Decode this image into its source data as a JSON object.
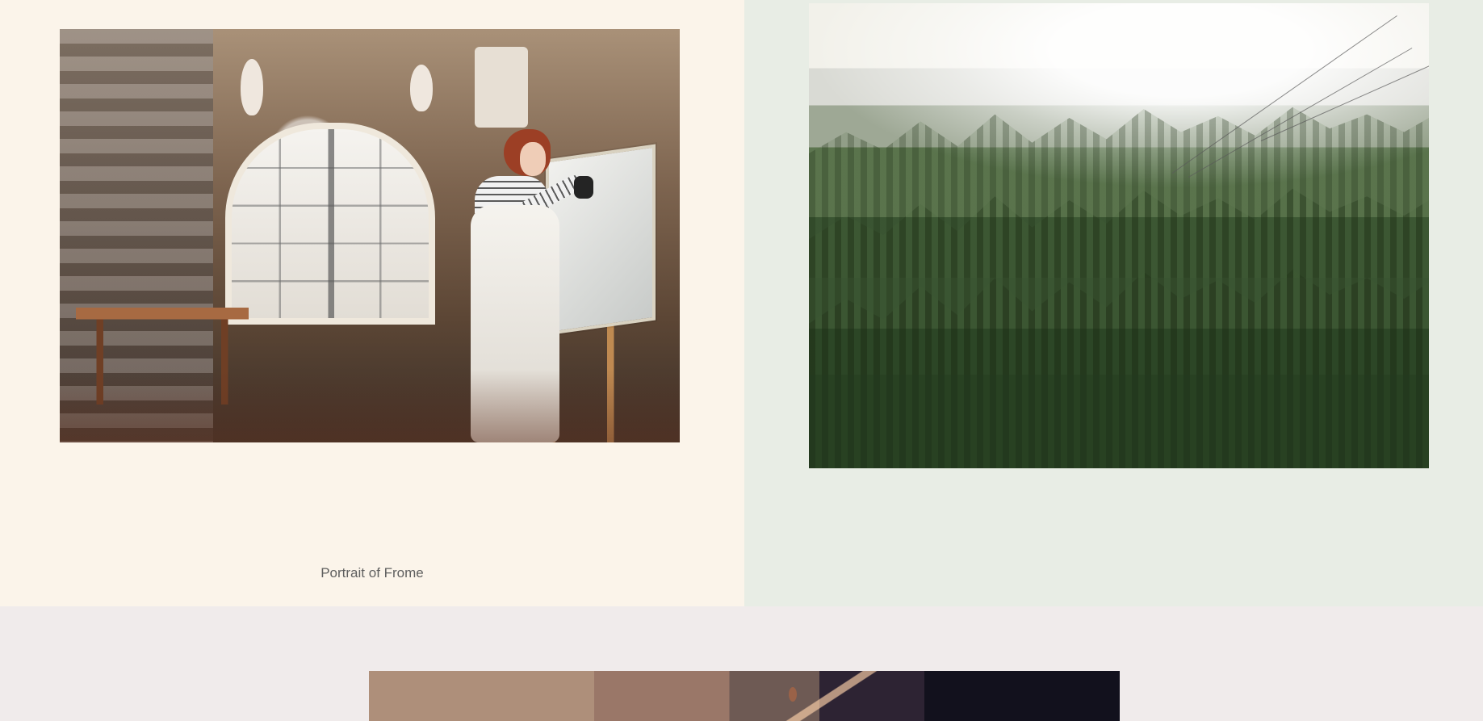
{
  "gallery": {
    "items": [
      {
        "caption": "Portrait of Frome"
      }
    ]
  }
}
